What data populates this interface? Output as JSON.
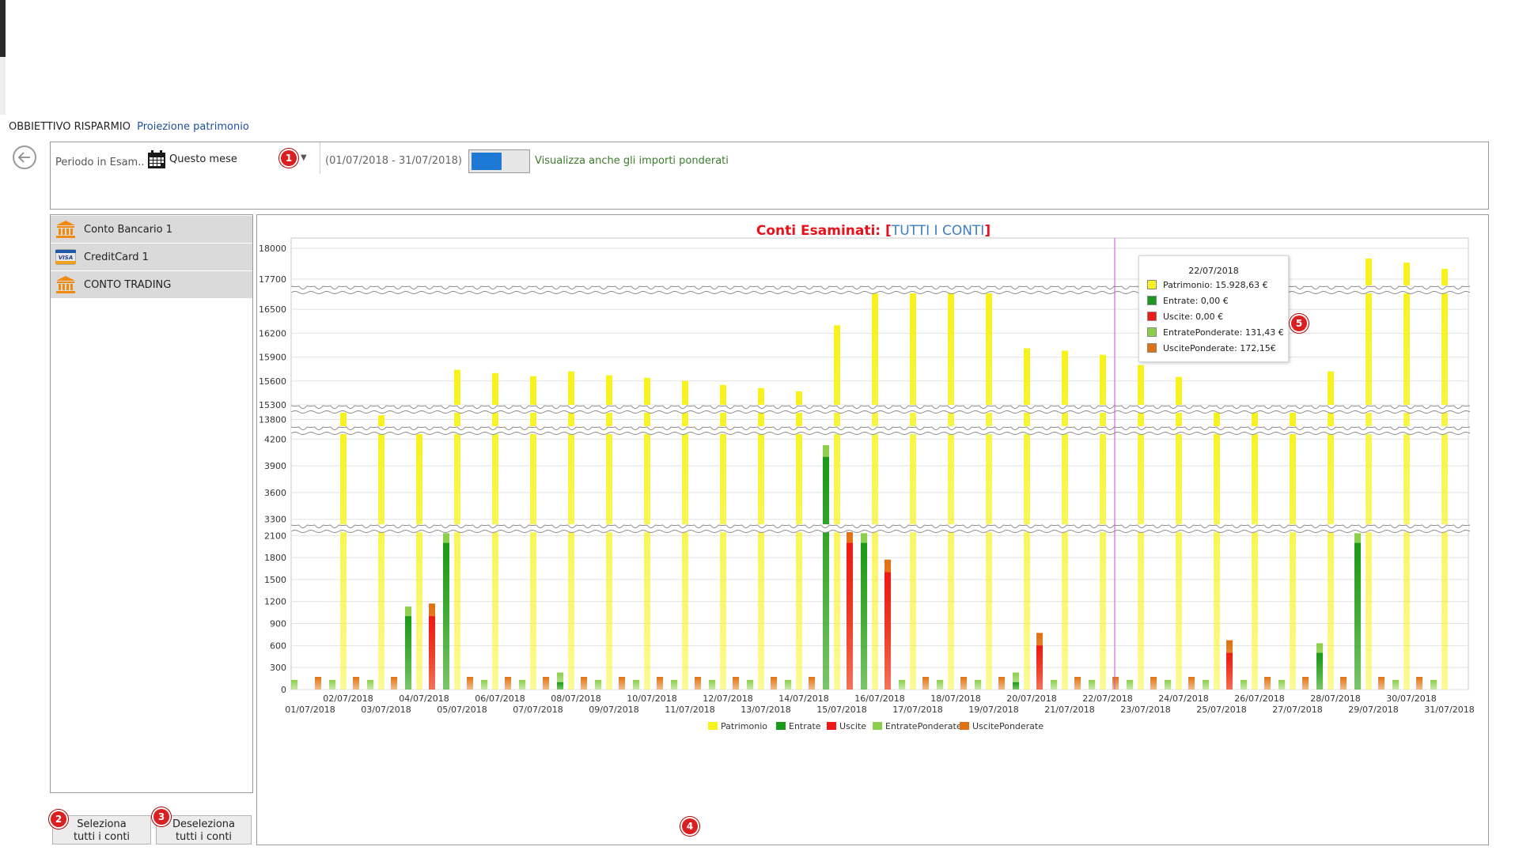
{
  "breadcrumb": {
    "section": "OBBIETTIVO RISPARMIO",
    "page": "Proiezione patrimonio"
  },
  "filter": {
    "periodo_label": "Periodo in Esam...",
    "period_value": "Questo mese",
    "date_range": "(01/07/2018 - 31/07/2018)",
    "toggle_label": "Visualizza anche gli importi ponderati",
    "toggle_on": true
  },
  "accounts": [
    {
      "label": "Conto Bancario 1",
      "icon": "bank-icon"
    },
    {
      "label": "CreditCard 1",
      "icon": "visa-card-icon"
    },
    {
      "label": "CONTO TRADING",
      "icon": "bank-icon"
    }
  ],
  "buttons": {
    "select_all_line1": "Seleziona",
    "select_all_line2": "tutti i conti",
    "deselect_all_line1": "Deseleziona",
    "deselect_all_line2": "tutti i conti"
  },
  "badges": {
    "b1": "1",
    "b2": "2",
    "b3": "3",
    "b4": "4",
    "b5": "5"
  },
  "chart_title": {
    "prefix": "Conti Esaminati:",
    "open": "[",
    "accounts": "TUTTI I CONTI",
    "close": "]"
  },
  "colors": {
    "patrimonio": "#f7f21a",
    "entrate": "#1a9a1a",
    "uscite": "#f01818",
    "entrate_ponderate": "#8ccf4a",
    "uscite_ponderate": "#e07010",
    "title_red": "#e8111b",
    "title_blue": "#3d7fc6",
    "crosshair": "#d24cd2"
  },
  "tooltip": {
    "title": "22/07/2018",
    "rows": [
      {
        "text": "Patrimonio: 15.928,63 €",
        "color": "#f7f21a"
      },
      {
        "text": "Entrate: 0,00 €",
        "color": "#1a9a1a"
      },
      {
        "text": "Uscite: 0,00 €",
        "color": "#f01818"
      },
      {
        "text": "EntratePonderate: 131,43 €",
        "color": "#8ccf4a"
      },
      {
        "text": "UscitePonderate: 172,15€",
        "color": "#e07010"
      }
    ]
  },
  "chart_data": {
    "type": "bar",
    "axis_breaks": [
      [
        4300,
        13750
      ],
      [
        13850,
        15250
      ],
      [
        16750,
        17600
      ]
    ],
    "yticks": [
      0,
      300,
      600,
      900,
      1200,
      1500,
      1800,
      2100,
      3300,
      3600,
      3900,
      4200,
      13800,
      15300,
      15600,
      15900,
      16200,
      16500,
      17700,
      18000
    ],
    "categories": [
      "01/07/2018",
      "02/07/2018",
      "03/07/2018",
      "04/07/2018",
      "05/07/2018",
      "06/07/2018",
      "07/07/2018",
      "08/07/2018",
      "09/07/2018",
      "10/07/2018",
      "11/07/2018",
      "12/07/2018",
      "13/07/2018",
      "14/07/2018",
      "15/07/2018",
      "16/07/2018",
      "17/07/2018",
      "18/07/2018",
      "19/07/2018",
      "20/07/2018",
      "21/07/2018",
      "22/07/2018",
      "23/07/2018",
      "24/07/2018",
      "25/07/2018",
      "26/07/2018",
      "27/07/2018",
      "28/07/2018",
      "29/07/2018",
      "30/07/2018",
      "31/07/2018"
    ],
    "series": [
      {
        "name": "Patrimonio",
        "values": [
          0,
          13850,
          13820,
          13760,
          15740,
          15700,
          15660,
          15720,
          15670,
          15640,
          15600,
          15550,
          15510,
          15470,
          16300,
          16920,
          16880,
          16850,
          16810,
          16010,
          15980,
          15928.63,
          15800,
          15650,
          15300,
          15270,
          15250,
          15720,
          17900,
          17860,
          17800
        ]
      },
      {
        "name": "Entrate",
        "values": [
          0,
          0,
          0,
          1000,
          2000,
          0,
          0,
          100,
          0,
          0,
          0,
          0,
          0,
          0,
          4000,
          2000,
          0,
          0,
          0,
          100,
          0,
          0,
          0,
          0,
          0,
          0,
          0,
          500,
          2000,
          0,
          0
        ]
      },
      {
        "name": "Uscite",
        "values": [
          0,
          0,
          0,
          1000,
          0,
          0,
          0,
          0,
          0,
          0,
          0,
          0,
          0,
          0,
          2000,
          1600,
          0,
          0,
          0,
          600,
          0,
          0,
          0,
          0,
          500,
          0,
          0,
          0,
          0,
          0,
          0
        ]
      },
      {
        "name": "EntratePonderate",
        "values": [
          131.43,
          131.43,
          131.43,
          1131.43,
          2131.43,
          131.43,
          131.43,
          231.43,
          131.43,
          131.43,
          131.43,
          131.43,
          131.43,
          131.43,
          4131.43,
          2131.43,
          131.43,
          131.43,
          131.43,
          231.43,
          131.43,
          131.43,
          131.43,
          131.43,
          131.43,
          131.43,
          131.43,
          631.43,
          2131.43,
          131.43,
          131.43
        ]
      },
      {
        "name": "UscitePonderate",
        "values": [
          172.15,
          172.15,
          172.15,
          1172.15,
          172.15,
          172.15,
          172.15,
          172.15,
          172.15,
          172.15,
          172.15,
          172.15,
          172.15,
          172.15,
          2172.15,
          1772.15,
          172.15,
          172.15,
          172.15,
          772.15,
          172.15,
          172.15,
          172.15,
          172.15,
          672.15,
          172.15,
          172.15,
          172.15,
          172.15,
          172.15,
          0
        ]
      }
    ],
    "legend": [
      "Patrimonio",
      "Entrate",
      "Uscite",
      "EntratePonderate",
      "UscitePonderate"
    ],
    "legend_position": "bottom-center",
    "crosshair_category": "22/07/2018",
    "grid": true
  }
}
